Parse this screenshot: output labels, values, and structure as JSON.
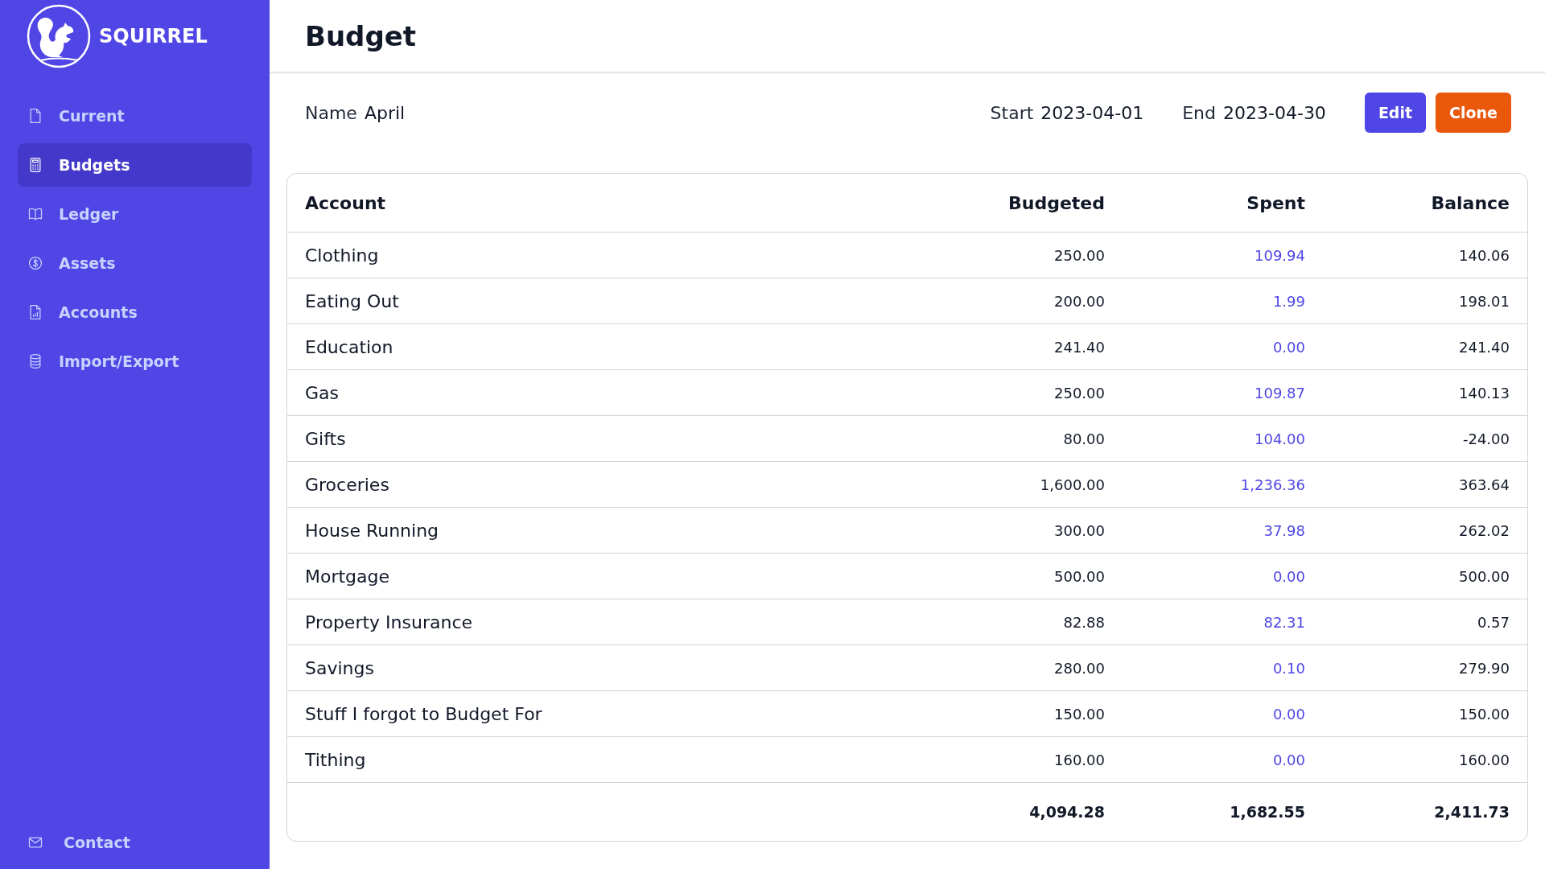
{
  "brand": {
    "name": "SQUIRREL"
  },
  "sidebar": {
    "items": [
      {
        "label": "Current",
        "kind": "file",
        "selected": false
      },
      {
        "label": "Budgets",
        "kind": "calculator",
        "selected": true
      },
      {
        "label": "Ledger",
        "kind": "book",
        "selected": false
      },
      {
        "label": "Assets",
        "kind": "dollar",
        "selected": false
      },
      {
        "label": "Accounts",
        "kind": "report",
        "selected": false
      },
      {
        "label": "Import/Export",
        "kind": "database",
        "selected": false
      }
    ],
    "footer": {
      "label": "Contact",
      "kind": "mail"
    }
  },
  "page": {
    "title": "Budget"
  },
  "details": {
    "name_label": "Name",
    "name": "April",
    "start_label": "Start",
    "start": "2023-04-01",
    "end_label": "End",
    "end": "2023-04-30"
  },
  "buttons": [
    {
      "label": "Edit",
      "kind": "primary"
    },
    {
      "label": "Clone",
      "kind": "accent"
    }
  ],
  "table": {
    "columns": [
      "Account",
      "Budgeted",
      "Spent",
      "Balance"
    ],
    "rows": [
      {
        "account": "Clothing",
        "budgeted": "250.00",
        "spent": "109.94",
        "balance": "140.06"
      },
      {
        "account": "Eating Out",
        "budgeted": "200.00",
        "spent": "1.99",
        "balance": "198.01"
      },
      {
        "account": "Education",
        "budgeted": "241.40",
        "spent": "0.00",
        "balance": "241.40"
      },
      {
        "account": "Gas",
        "budgeted": "250.00",
        "spent": "109.87",
        "balance": "140.13"
      },
      {
        "account": "Gifts",
        "budgeted": "80.00",
        "spent": "104.00",
        "balance": "-24.00"
      },
      {
        "account": "Groceries",
        "budgeted": "1,600.00",
        "spent": "1,236.36",
        "balance": "363.64"
      },
      {
        "account": "House Running",
        "budgeted": "300.00",
        "spent": "37.98",
        "balance": "262.02"
      },
      {
        "account": "Mortgage",
        "budgeted": "500.00",
        "spent": "0.00",
        "balance": "500.00"
      },
      {
        "account": "Property Insurance",
        "budgeted": "82.88",
        "spent": "82.31",
        "balance": "0.57"
      },
      {
        "account": "Savings",
        "budgeted": "280.00",
        "spent": "0.10",
        "balance": "279.90"
      },
      {
        "account": "Stuff I forgot to Budget For",
        "budgeted": "150.00",
        "spent": "0.00",
        "balance": "150.00"
      },
      {
        "account": "Tithing",
        "budgeted": "160.00",
        "spent": "0.00",
        "balance": "160.00"
      }
    ],
    "totals": {
      "budgeted": "4,094.28",
      "spent": "1,682.55",
      "balance": "2,411.73"
    }
  }
}
